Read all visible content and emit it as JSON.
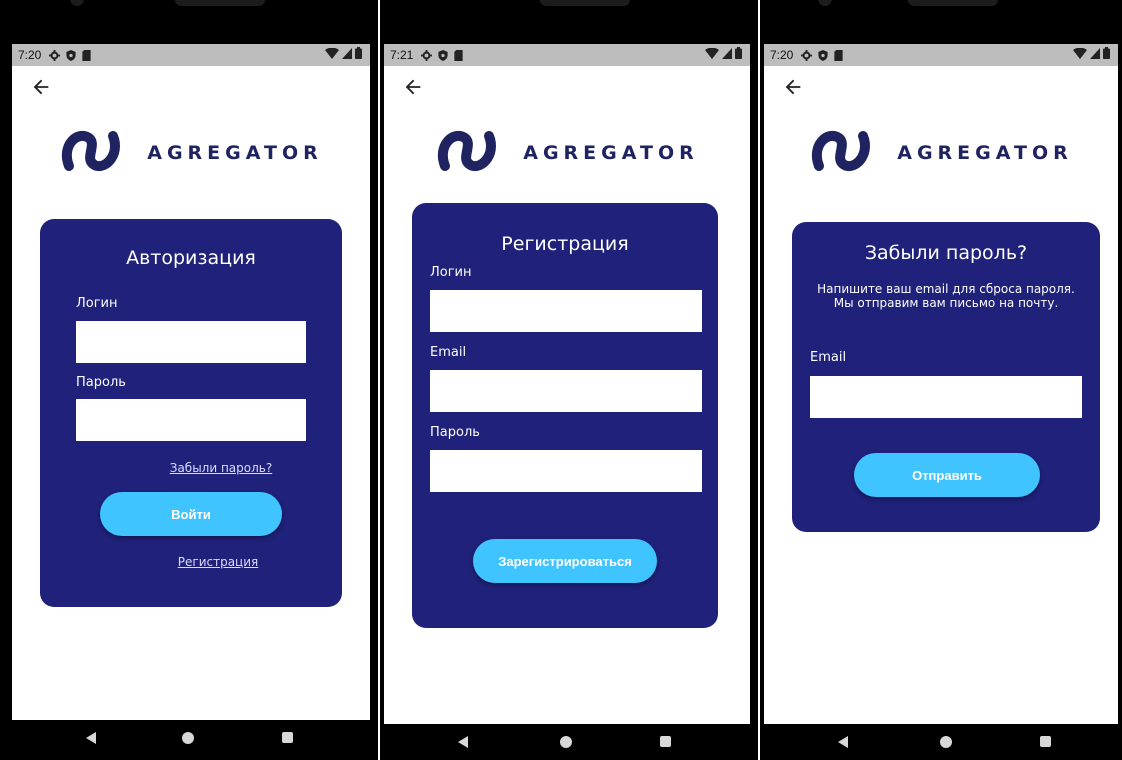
{
  "screens": [
    {
      "status": {
        "time": "7:20"
      },
      "title": "Авторизация",
      "login_label": "Логин",
      "password_label": "Пароль",
      "forgot_link": "Забыли пароль?",
      "submit_label": "Войти",
      "register_link": "Регистрация"
    },
    {
      "status": {
        "time": "7:21"
      },
      "title": "Регистрация",
      "login_label": "Логин",
      "email_label": "Email",
      "password_label": "Пароль",
      "submit_label": "Зарегистрироваться"
    },
    {
      "status": {
        "time": "7:20"
      },
      "title": "Забыли пароль?",
      "description": "Напишите ваш email для сброса пароля. Мы отправим вам письмо на почту.",
      "email_label": "Email",
      "submit_label": "Отправить"
    }
  ],
  "logo": {
    "text": "AGREGATOR"
  },
  "colors": {
    "card_bg": "#1f217a",
    "button_bg": "#40c4ff",
    "logo_color": "#1f2360",
    "status_bar_bg": "#bdbdbd"
  },
  "icons": {
    "back": "arrow-left-icon",
    "settings": "gear-icon",
    "shield": "shield-icon",
    "sd_card": "sd-card-icon",
    "wifi": "wifi-icon",
    "signal": "signal-icon",
    "battery": "battery-icon",
    "nav_back": "nav-back-icon",
    "nav_home": "nav-home-icon",
    "nav_recents": "nav-recents-icon"
  }
}
